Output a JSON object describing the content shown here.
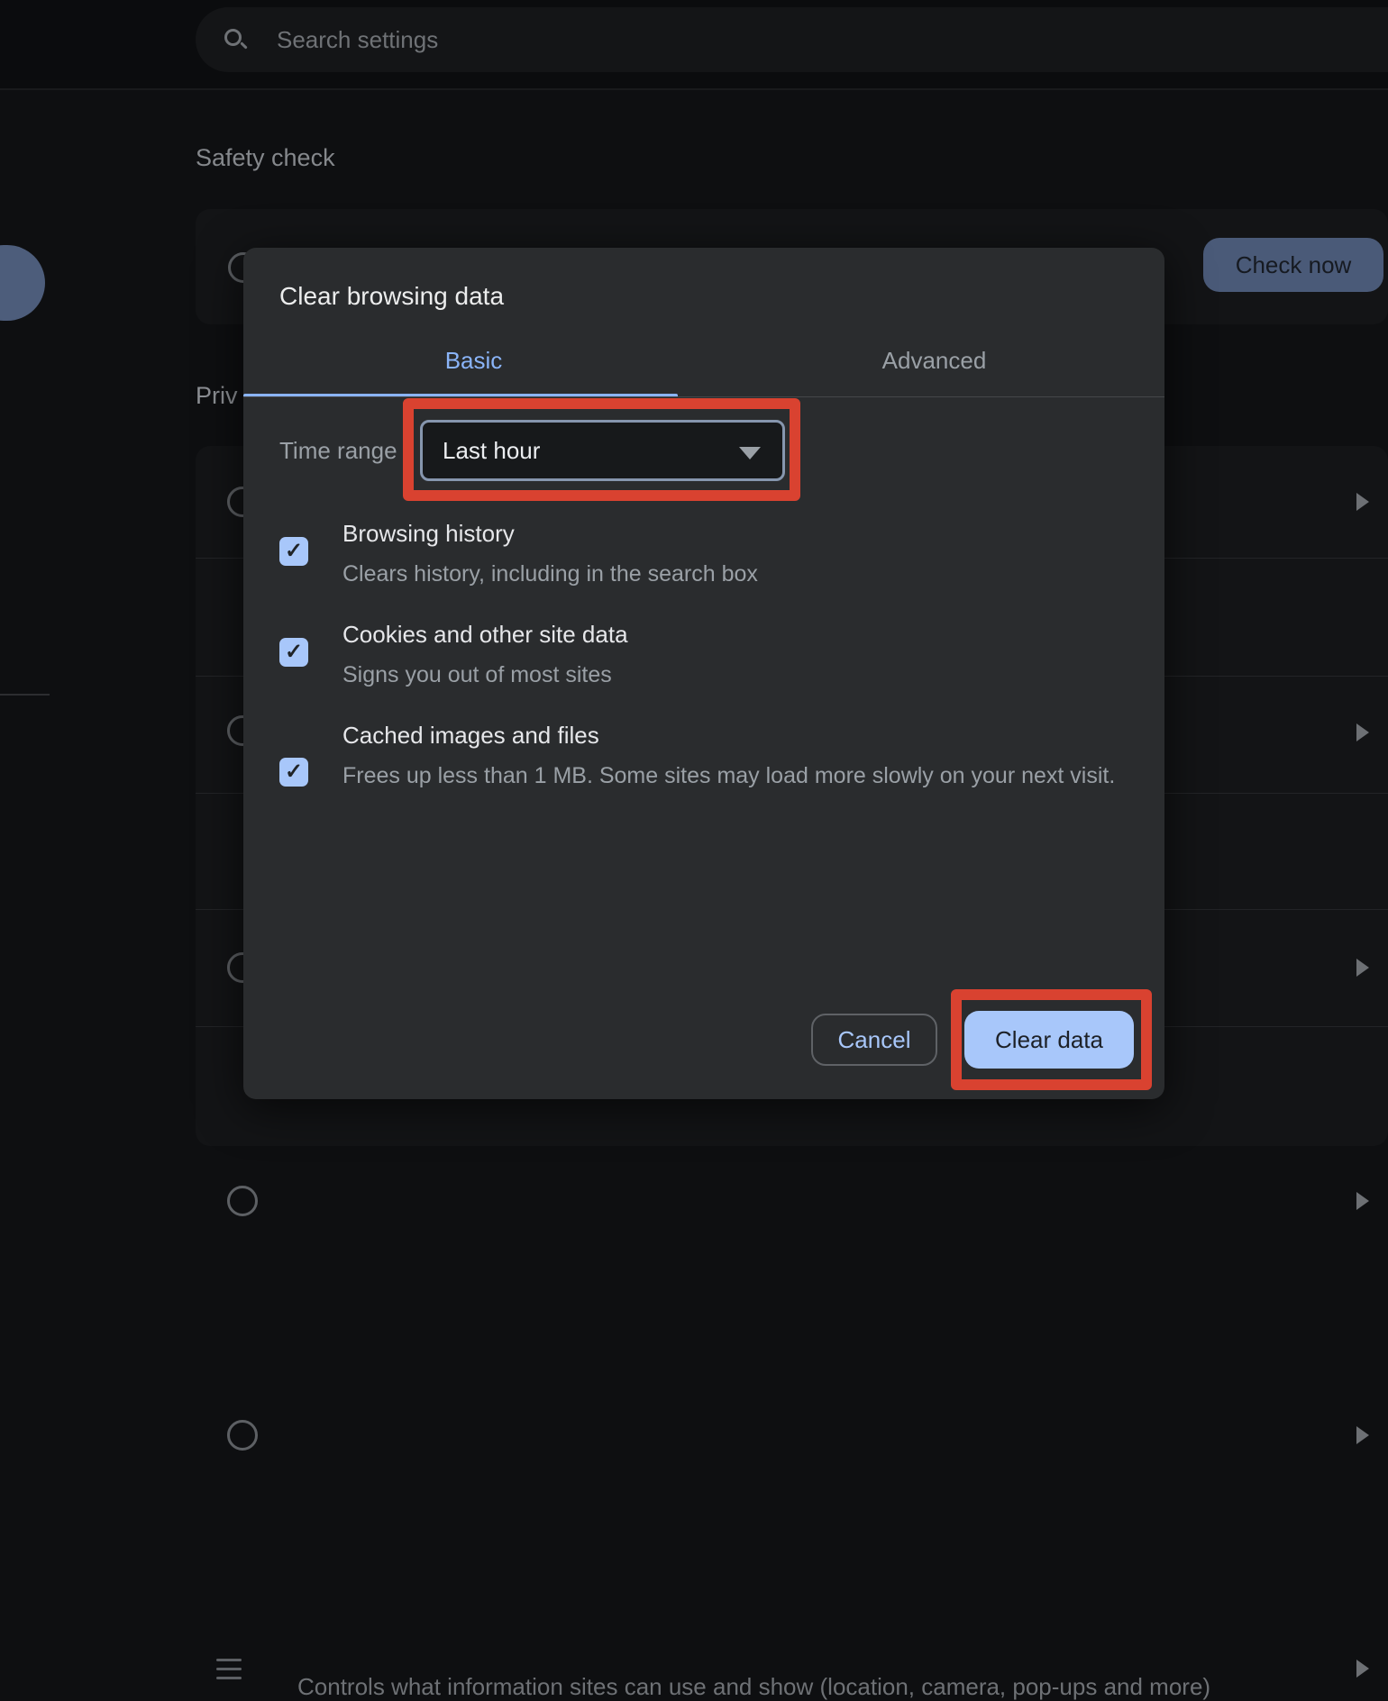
{
  "header": {
    "search_placeholder": "Search settings"
  },
  "page": {
    "safety_section_title": "Safety check",
    "check_now_label": "Check now",
    "privacy_section_title_partial": "Priv",
    "site_settings_subtitle": "Controls what information sites can use and show (location, camera, pop-ups and more)"
  },
  "dialog": {
    "title": "Clear browsing data",
    "tabs": [
      {
        "label": "Basic",
        "selected": true
      },
      {
        "label": "Advanced",
        "selected": false
      }
    ],
    "time_range": {
      "label": "Time range",
      "value": "Last hour"
    },
    "items": [
      {
        "title": "Browsing history",
        "subtitle": "Clears history, including in the search box",
        "checked": true
      },
      {
        "title": "Cookies and other site data",
        "subtitle": "Signs you out of most sites",
        "checked": true
      },
      {
        "title": "Cached images and files",
        "subtitle": "Frees up less than 1 MB. Some sites may load more slowly on your next visit.",
        "checked": true
      }
    ],
    "cancel_label": "Cancel",
    "confirm_label": "Clear data"
  },
  "icons": {
    "checkmark": "✓"
  },
  "colors": {
    "accent_blue": "#8ab4f8",
    "control_blue": "#a8c7fa",
    "annotation_red": "#d94230",
    "dialog_bg": "#2a2c2e",
    "page_bg": "#0e0f11"
  }
}
